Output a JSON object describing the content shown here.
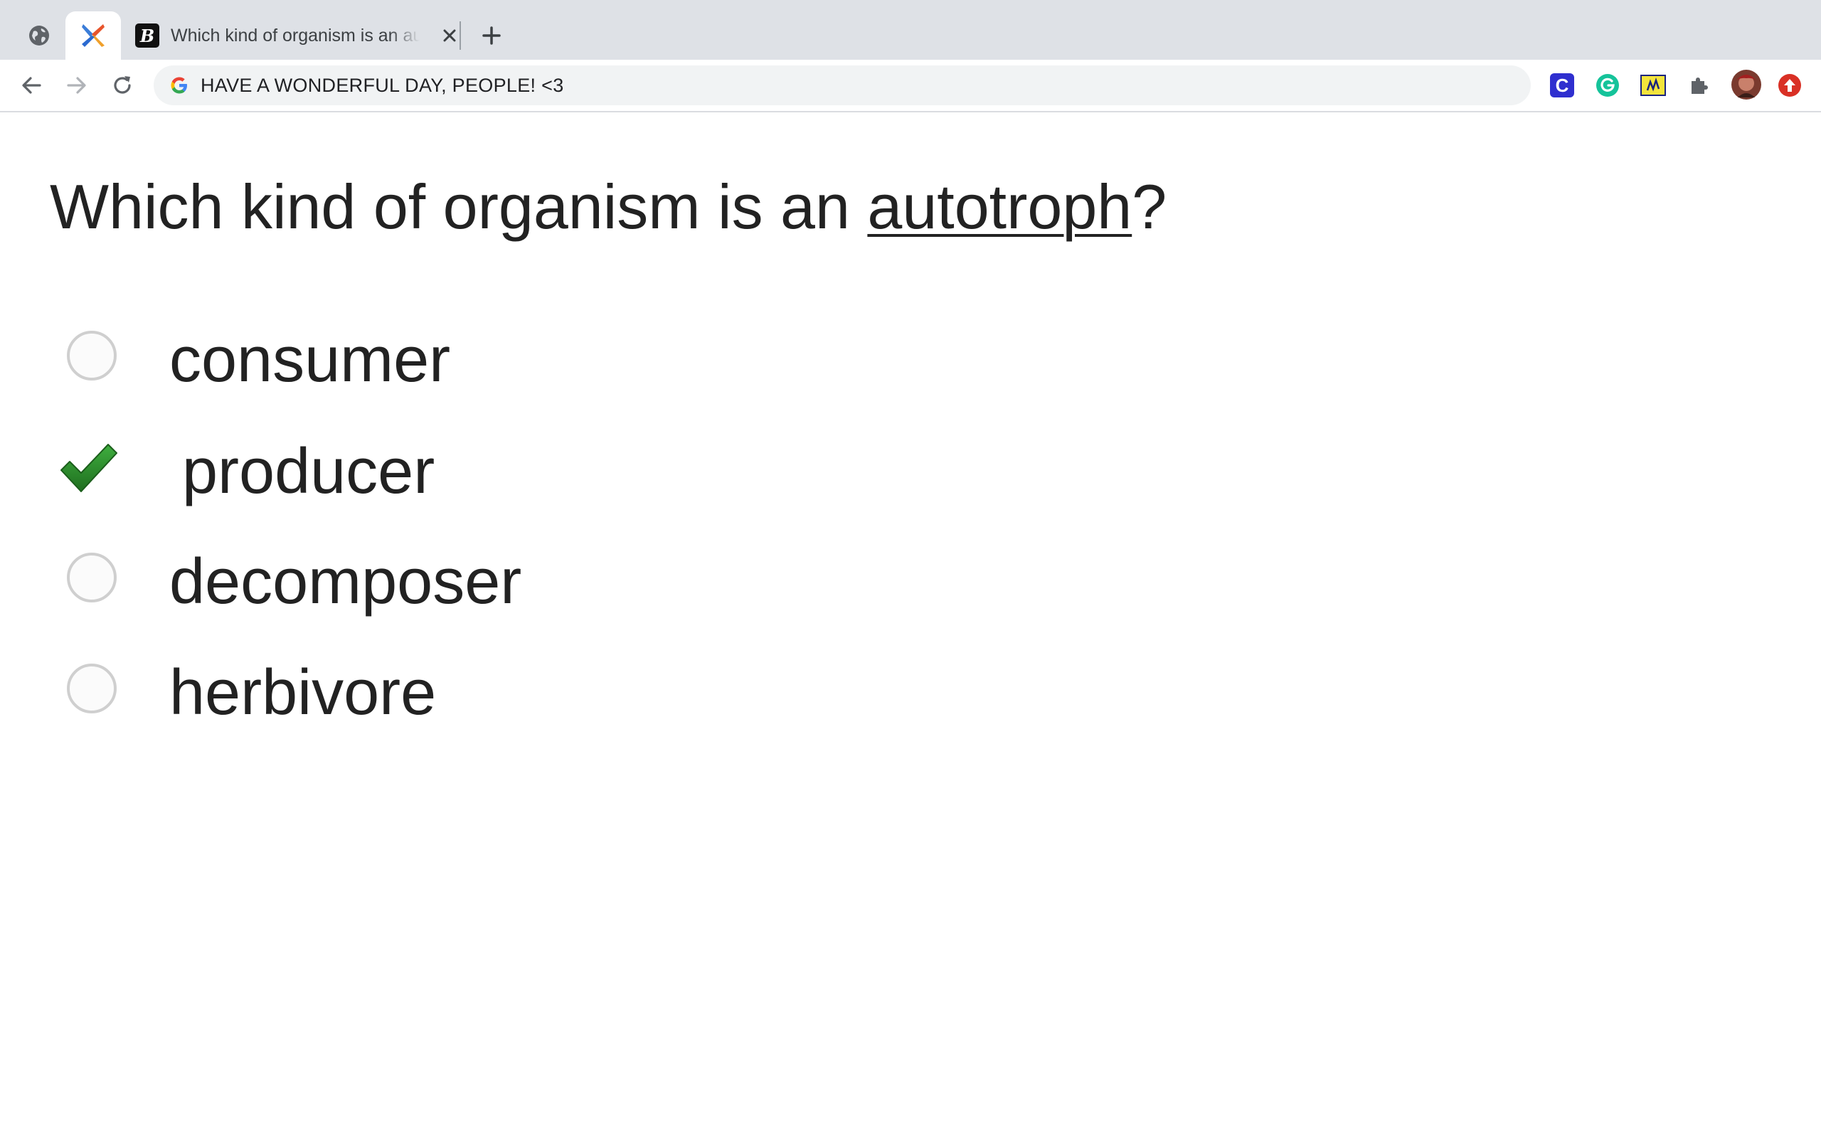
{
  "browser": {
    "tabs": [
      {
        "kind": "pinned",
        "icon": "globe-icon"
      },
      {
        "kind": "pinned",
        "icon": "x-logo-icon",
        "active": true
      },
      {
        "kind": "normal",
        "icon": "b-logo-icon",
        "favicon_letter": "B",
        "title": "Which kind of organism is an autotroph?"
      }
    ],
    "omnibox": {
      "search_icon_letter": "G",
      "value": "HAVE A WONDERFUL DAY, PEOPLE! <3"
    },
    "extensions": [
      {
        "name": "c-extension-icon",
        "letter": "C",
        "color": "#2f2fcf"
      },
      {
        "name": "grammarly-icon",
        "color": "#15c39a"
      },
      {
        "name": "notes-extension-icon",
        "color": "#f3e43c"
      },
      {
        "name": "puzzle-icon",
        "color": "#5f6368"
      },
      {
        "name": "avatar",
        "color": "#7a3a2e"
      },
      {
        "name": "update-icon",
        "color": "#d93025"
      }
    ]
  },
  "question": {
    "prefix": "Which kind of organism is an ",
    "term": "autotroph",
    "suffix": "?"
  },
  "choices": [
    {
      "label": "consumer",
      "selected": false
    },
    {
      "label": "producer",
      "selected": true
    },
    {
      "label": "decomposer",
      "selected": false
    },
    {
      "label": "herbivore",
      "selected": false
    }
  ],
  "colors": {
    "check_green": "#2e8b2e",
    "text": "#222222"
  }
}
